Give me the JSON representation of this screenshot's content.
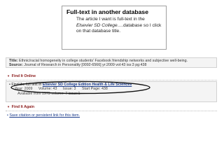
{
  "callout": {
    "title": "Full-text in another database",
    "body_before": "The article I want is full-text in the ",
    "body_italic": "Elsevier SD College",
    "body_after": "….database so I click on that database title."
  },
  "citation": {
    "title_label": "Title:",
    "title_value": "Ethnic/racial homogeneity in college students' Facebook friendship networks and subjective well-being.",
    "source_label": "Source:",
    "source_value": "Journal of Research in Personality [0092-6566] yr:2009 vol:43 iss:3 pg:438"
  },
  "find_online": {
    "heading": "Find It Online",
    "fulltext_prefix": "Find the full text in ",
    "database_link": "Elsevier SD College Edition Health & Life Sciences",
    "year": "Year:  2009",
    "volume": "Volume:  43",
    "issue": "Issue:  3",
    "start_page": "Start Page:  438",
    "available": "Available from 1973 volume: 7 issue:1"
  },
  "find_again": {
    "heading": "Find It Again",
    "save_link": "Save citation or persistent link for this item."
  }
}
